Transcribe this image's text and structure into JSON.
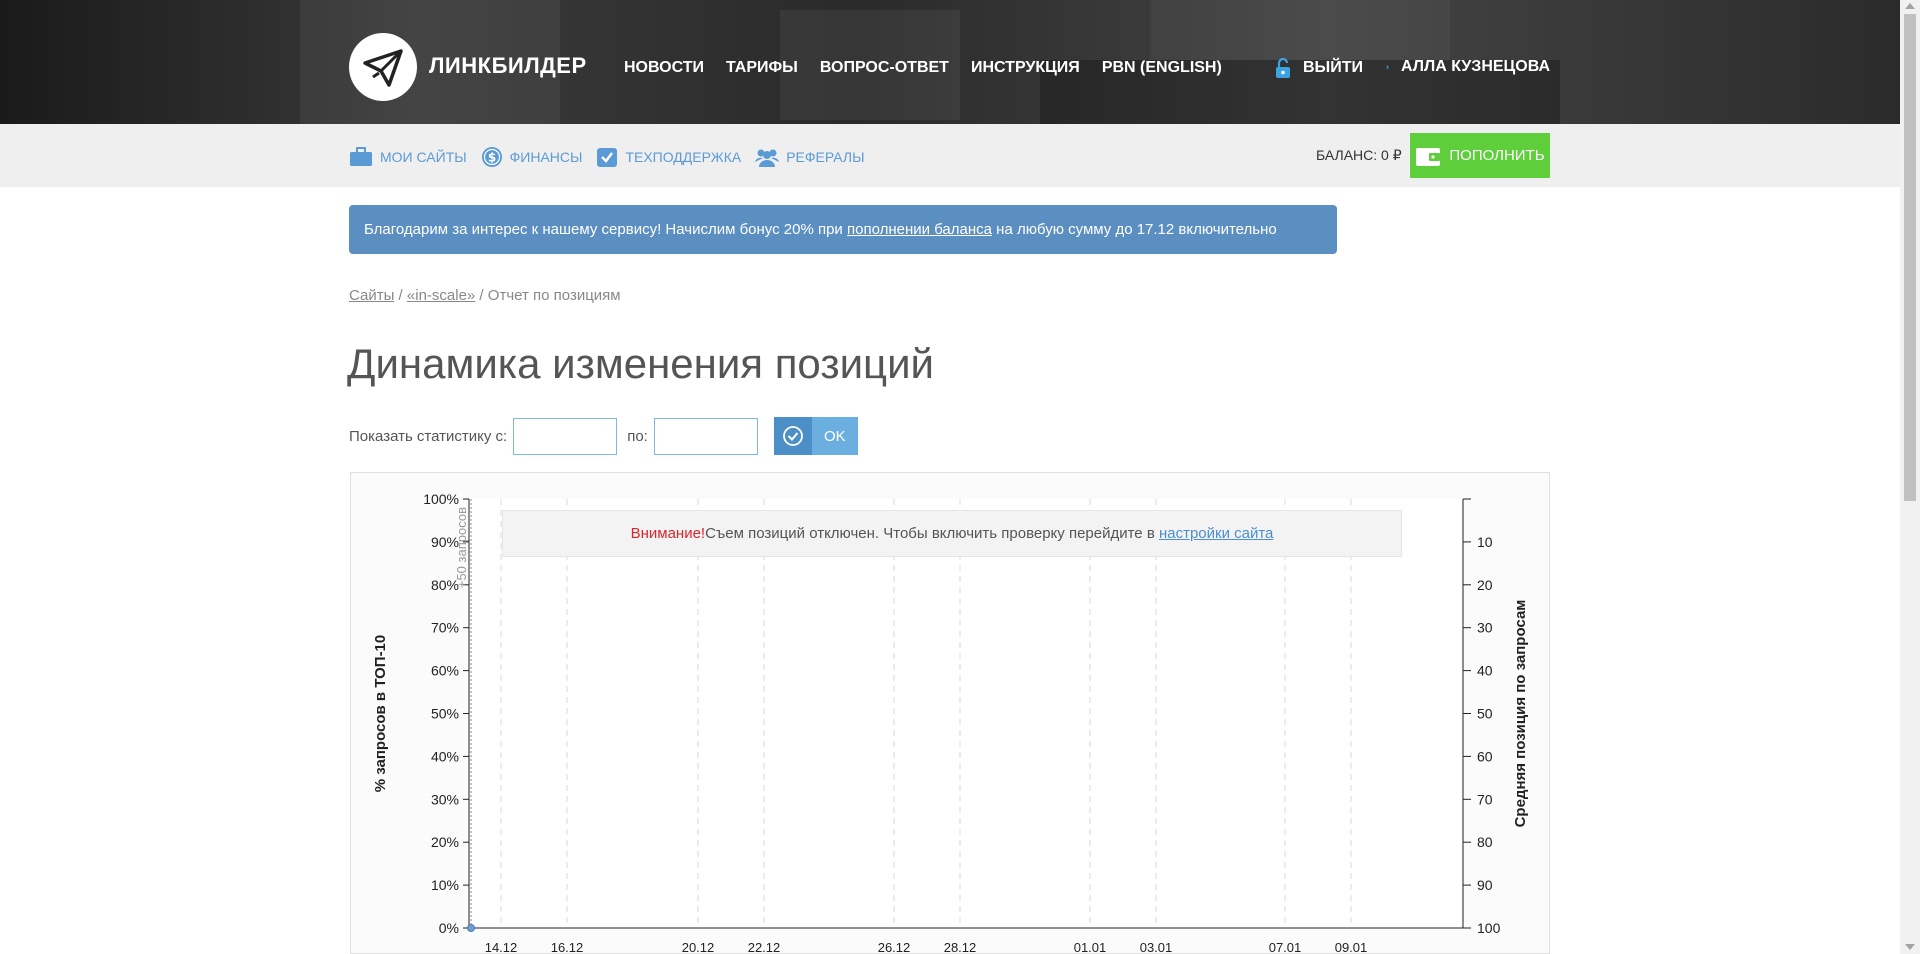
{
  "header": {
    "brand": "ЛИНКБИЛДЕР",
    "nav": [
      "НОВОСТИ",
      "ТАРИФЫ",
      "ВОПРОС-ОТВЕТ",
      "ИНСТРУКЦИЯ",
      "PBN (ENGLISH)"
    ],
    "logout": "ВЫЙТИ",
    "user": "АЛЛА КУЗНЕЦОВА"
  },
  "subnav": {
    "items": [
      {
        "label": "МОИ САЙТЫ",
        "icon": "briefcase-icon"
      },
      {
        "label": "ФИНАНСЫ",
        "icon": "dollar-icon"
      },
      {
        "label": "ТЕХПОДДЕРЖКА",
        "icon": "check-shield-icon"
      },
      {
        "label": "РЕФЕРАЛЫ",
        "icon": "users-icon"
      }
    ],
    "balance": "БАЛАНС: 0 ₽",
    "topup": "ПОПОЛНИТЬ"
  },
  "promo": {
    "before": "Благодарим за интерес к нашему сервису! Начислим бонус 20% при ",
    "link": "пополнении баланса",
    "after": " на любую сумму до 17.12 включительно"
  },
  "breadcrumbs": {
    "root": "Сайты",
    "sep1": " / ",
    "site": "«in-scale»",
    "sep2": " / ",
    "current": "Отчет по позициям"
  },
  "page": {
    "title": "Динамика изменения позиций"
  },
  "filter": {
    "from_label": "Показать статистику с:",
    "to_label": "по:",
    "from_value": "",
    "to_value": "",
    "ok": "OK"
  },
  "notice": {
    "warn": "Внимание!",
    "text": " Съем позиций отключен. Чтобы включить проверку перейдите в ",
    "link": "настройки сайта"
  },
  "colors": {
    "accent": "#5b9bd5",
    "topup": "#5ecf3b",
    "promo": "#5b8ec1",
    "warning": "#d9262c"
  },
  "chart_data": {
    "type": "line",
    "ylabel": "% запросов в ТОП-10",
    "y2label": "Средняя позиция по запросам",
    "ylim": [
      0,
      100
    ],
    "y2lim": [
      0,
      100
    ],
    "y2_reversed": true,
    "y_ticks": [
      "100%",
      "90%",
      "80%",
      "70%",
      "60%",
      "50%",
      "40%",
      "30%",
      "20%",
      "10%",
      "0%"
    ],
    "y2_ticks": [
      "10",
      "20",
      "30",
      "40",
      "50",
      "60",
      "70",
      "80",
      "90",
      "100"
    ],
    "x_ticks": [
      "14.12",
      "16.12",
      "20.12",
      "22.12",
      "26.12",
      "28.12",
      "01.01",
      "03.01",
      "07.01",
      "09.01"
    ],
    "annotation": "+50 запросов",
    "series": [
      {
        "values": [
          0
        ]
      }
    ],
    "grid": true
  }
}
